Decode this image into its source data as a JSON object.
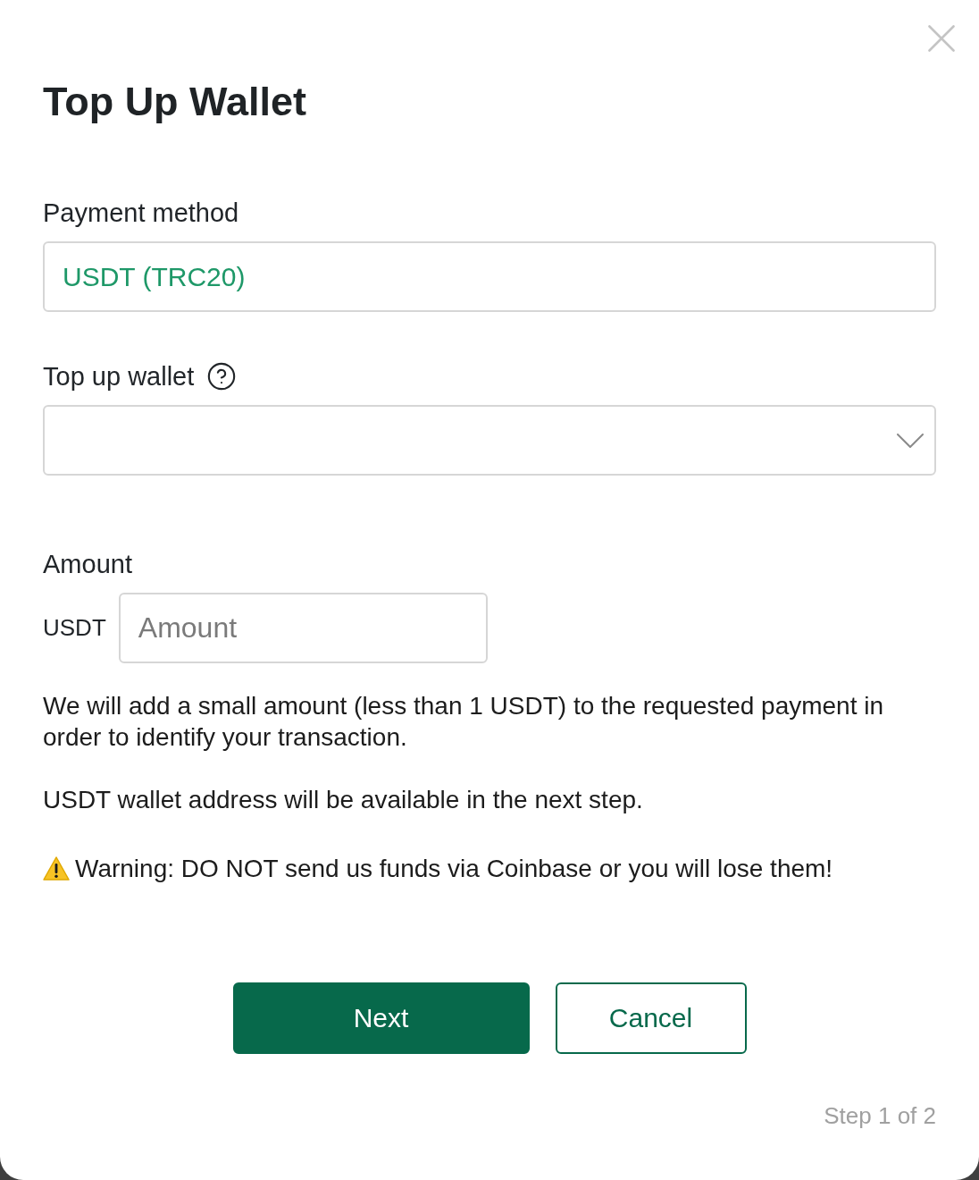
{
  "title": "Top Up Wallet",
  "payment_method": {
    "label": "Payment method",
    "value": "USDT (TRC20)"
  },
  "top_up_wallet": {
    "label": "Top up wallet"
  },
  "amount": {
    "label": "Amount",
    "currency": "USDT",
    "placeholder": "Amount"
  },
  "notes": [
    "We will add a small amount (less than 1 USDT) to the requested payment in order to identify your transaction.",
    "USDT wallet address will be available in the next step."
  ],
  "warning": "Warning: DO NOT send us funds via Coinbase or you will lose them!",
  "buttons": [
    {
      "label": "Next",
      "kind": "primary"
    },
    {
      "label": "Cancel",
      "kind": "secondary"
    }
  ],
  "step": "Step 1 of 2"
}
